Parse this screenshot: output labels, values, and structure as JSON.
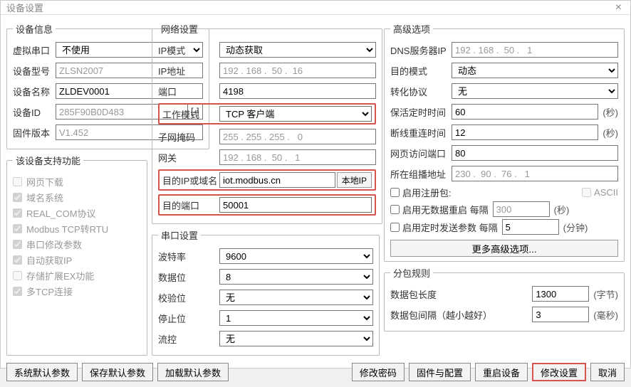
{
  "title": "设备设置",
  "sections": {
    "device_info": "设备信息",
    "features": "该设备支持功能",
    "network": "网络设置",
    "serial": "串口设置",
    "advanced": "高级选项",
    "packet": "分包规则"
  },
  "device": {
    "virtual_serial_label": "虚拟串口",
    "virtual_serial_value": "不使用",
    "model_label": "设备型号",
    "model_value": "ZLSN2007",
    "name_label": "设备名称",
    "name_value": "ZLDEV0001",
    "id_label": "设备ID",
    "id_value": "285F90B0D483",
    "id_suffix": "[-]",
    "firmware_label": "固件版本",
    "firmware_value": "V1.452"
  },
  "features": {
    "web_download": "网页下载",
    "dns": "域名系统",
    "real_com": "REAL_COM协议",
    "modbus": "Modbus TCP转RTU",
    "serial_mod": "串口修改参数",
    "auto_ip": "自动获取IP",
    "storage_ex": "存储扩展EX功能",
    "multi_tcp": "多TCP连接"
  },
  "net": {
    "ip_mode_label": "IP模式",
    "ip_mode_value": "动态获取",
    "ip_addr_label": "IP地址",
    "ip_addr_value": "192 . 168 .  50 .  16",
    "port_label": "端口",
    "port_value": "4198",
    "work_mode_label": "工作模式",
    "work_mode_value": "TCP 客户端",
    "netmask_label": "子网掩码",
    "netmask_value": "255 . 255 . 255 .   0",
    "gateway_label": "网关",
    "gateway_value": "192 . 168 .  50 .   1",
    "dest_ip_label": "目的IP或域名",
    "dest_ip_value": "iot.modbus.cn",
    "local_ip_btn": "本地IP",
    "dest_port_label": "目的端口",
    "dest_port_value": "50001"
  },
  "serial": {
    "baud_label": "波特率",
    "baud_value": "9600",
    "databits_label": "数据位",
    "databits_value": "8",
    "parity_label": "校验位",
    "parity_value": "无",
    "stopbits_label": "停止位",
    "stopbits_value": "1",
    "flow_label": "流控",
    "flow_value": "无"
  },
  "adv": {
    "dns_label": "DNS服务器IP",
    "dns_value": "192 . 168 .  50 .   1",
    "dest_mode_label": "目的模式",
    "dest_mode_value": "动态",
    "proto_label": "转化协议",
    "proto_value": "无",
    "keepalive_label": "保活定时时间",
    "keepalive_value": "60",
    "keepalive_unit": "(秒)",
    "reconnect_label": "断线重连时间",
    "reconnect_value": "12",
    "reconnect_unit": "(秒)",
    "web_port_label": "网页访问端口",
    "web_port_value": "80",
    "multicast_label": "所在组播地址",
    "multicast_value": "230 .  90 .  76 .   1",
    "reg_pkt_label": "启用注册包:",
    "ascii_label": "ASCII",
    "nodata_label": "启用无数据重启  每隔",
    "nodata_value": "300",
    "nodata_unit": "(秒)",
    "timed_label": "启用定时发送参数 每隔",
    "timed_value": "5",
    "timed_unit": "(分钟)",
    "more_btn": "更多高级选项..."
  },
  "packet": {
    "len_label": "数据包长度",
    "len_value": "1300",
    "len_unit": "(字节)",
    "interval_label": "数据包间隔（越小越好）",
    "interval_value": "3",
    "interval_unit": "(毫秒)"
  },
  "buttons": {
    "sys_default": "系统默认参数",
    "save_default": "保存默认参数",
    "load_default": "加载默认参数",
    "change_pwd": "修改密码",
    "firmware_cfg": "固件与配置",
    "restart": "重启设备",
    "apply": "修改设置",
    "cancel": "取消"
  }
}
